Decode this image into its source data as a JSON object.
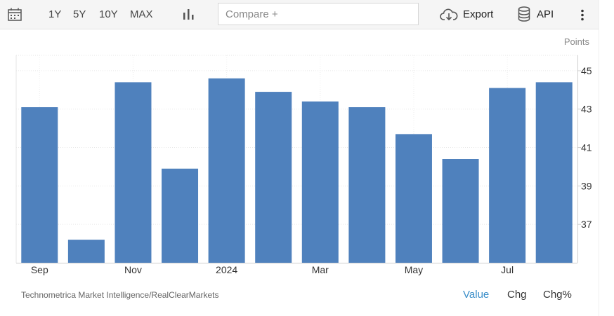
{
  "toolbar": {
    "ranges": [
      "1Y",
      "5Y",
      "10Y",
      "MAX"
    ],
    "compare_placeholder": "Compare +",
    "export_label": "Export",
    "api_label": "API"
  },
  "chart_data": {
    "type": "bar",
    "units": "Points",
    "x_tick_labels": [
      "Sep",
      "Nov",
      "2024",
      "Mar",
      "May",
      "Jul"
    ],
    "values": [
      43.1,
      36.2,
      44.4,
      39.9,
      44.6,
      43.9,
      43.4,
      43.1,
      41.7,
      40.4,
      44.1,
      44.4
    ],
    "ylim": [
      35.0,
      45.8
    ],
    "yticks": [
      37,
      39,
      41,
      43,
      45
    ],
    "color": "#4f81bd",
    "grid": true
  },
  "footer": {
    "source": "Technometrica Market Intelligence/RealClearMarkets",
    "views": [
      "Value",
      "Chg",
      "Chg%"
    ],
    "active_view": "Value"
  }
}
